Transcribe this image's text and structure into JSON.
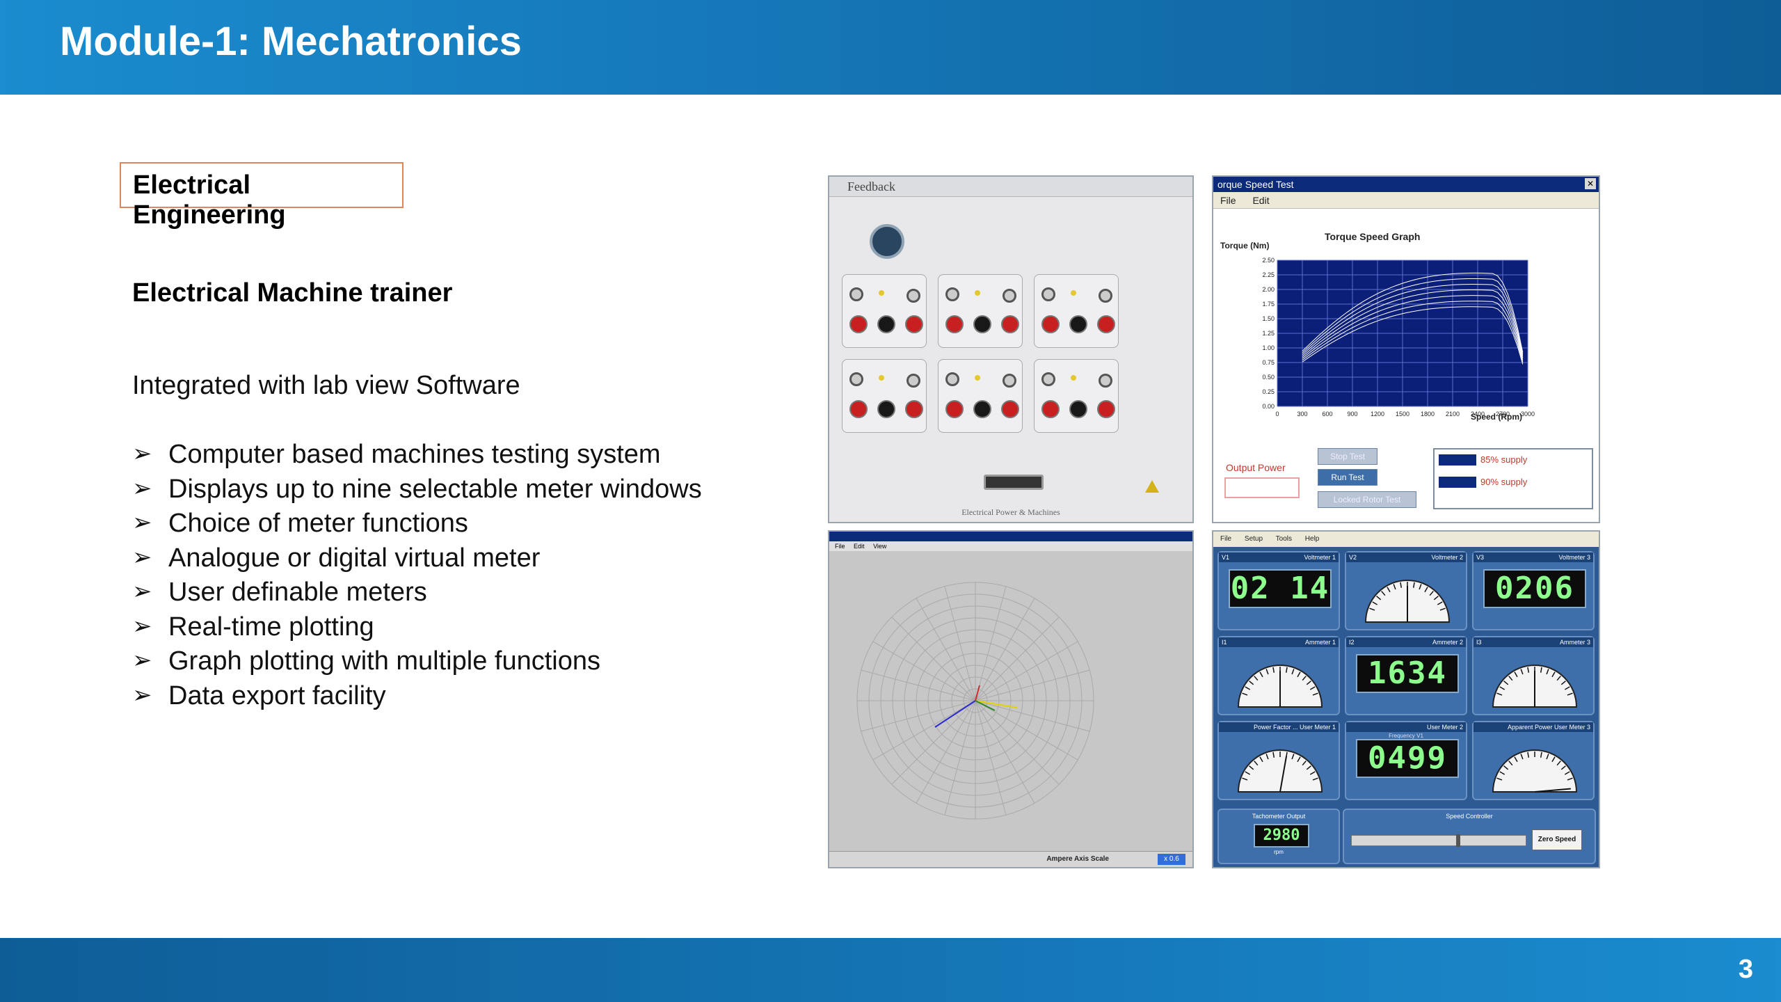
{
  "header": {
    "title": "Module-1: Mechatronics"
  },
  "footer": {
    "page_number": "3"
  },
  "content": {
    "tag": "Electrical Engineering",
    "subheading": "Electrical Machine trainer",
    "intro": "Integrated with lab view Software",
    "bullets": [
      "Computer based machines testing system",
      "Displays up to nine selectable meter windows",
      "Choice of meter functions",
      "Analogue or digital virtual meter",
      "User definable meters",
      "Real-time plotting",
      "Graph plotting with multiple functions",
      "Data export facility"
    ]
  },
  "trainer": {
    "brand": "Feedback",
    "footer": "Electrical Power & Machines"
  },
  "torque_window": {
    "title": "orque Speed Test",
    "menu": [
      "File",
      "Edit"
    ],
    "graph_title": "Torque Speed Graph",
    "y_label": "Torque (Nm)",
    "x_label": "Speed (Rpm)",
    "y_ticks": [
      "2.50",
      "2.25",
      "2.00",
      "1.75",
      "1.50",
      "1.25",
      "1.00",
      "0.75",
      "0.50",
      "0.25",
      "0.00"
    ],
    "x_ticks": [
      "0",
      "300",
      "600",
      "900",
      "1200",
      "1500",
      "1800",
      "2100",
      "2400",
      "2700",
      "3000"
    ],
    "output_label": "Output Power",
    "buttons": [
      "Stop Test",
      "Run Test",
      "Locked Rotor Test"
    ],
    "list_items": [
      "85% supply",
      "90% supply"
    ],
    "colors": {
      "plot_bg": "#0b1f78",
      "curve": "#ffffff",
      "grid": "#5c6fd0",
      "run_btn": "#3d6ea8"
    }
  },
  "phasor_window": {
    "menu": [
      "File",
      "Edit",
      "View"
    ],
    "axis_label": "Ampere Axis Scale",
    "axis_value": "x 0.6"
  },
  "meters_window": {
    "menu": [
      "File",
      "Setup",
      "Tools",
      "Help"
    ],
    "meters": [
      {
        "code": "V1",
        "name": "Voltmeter 1",
        "type": "digital",
        "display": "02 14"
      },
      {
        "code": "V2",
        "name": "Voltmeter 2",
        "type": "analogue"
      },
      {
        "code": "V3",
        "name": "Voltmeter 3",
        "type": "digital",
        "display": "0206"
      },
      {
        "code": "I1",
        "name": "Ammeter 1",
        "type": "analogue"
      },
      {
        "code": "I2",
        "name": "Ammeter 2",
        "type": "digital",
        "display": "1634"
      },
      {
        "code": "I3",
        "name": "Ammeter 3",
        "type": "analogue"
      },
      {
        "code": "",
        "name": "Power Factor ... User Meter 1",
        "type": "analogue"
      },
      {
        "code": "",
        "name": "User Meter 2",
        "type": "digital",
        "display": "0499",
        "sub": "Frequency V1"
      },
      {
        "code": "",
        "name": "Apparent Power User Meter 3",
        "type": "analogue"
      }
    ],
    "tacho_label": "Tachometer Output",
    "tacho_value": "2980",
    "tacho_unit": "rpm",
    "speed_label": "Speed Controller",
    "zero_button": "Zero Speed"
  }
}
